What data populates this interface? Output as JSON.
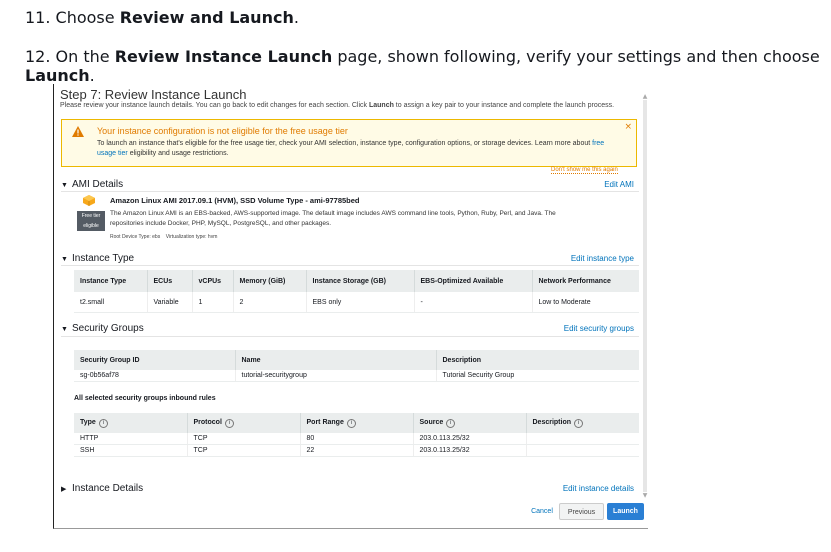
{
  "doc": {
    "step11": {
      "prefix": "11. Choose ",
      "bold": "Review and Launch",
      "suffix": "."
    },
    "step12": {
      "prefix": "12. On the ",
      "bold1": "Review Instance Launch",
      "middle": " page, shown following, verify your settings and then choose ",
      "bold2": "Launch",
      "suffix": "."
    }
  },
  "console": {
    "title": "Step 7: Review Instance Launch",
    "subtitle_pre": "Please review your instance launch details. You can go back to edit changes for each section. Click ",
    "subtitle_bold": "Launch",
    "subtitle_post": " to assign a key pair to your instance and complete the launch process.",
    "alert": {
      "title": "Your instance configuration is not eligible for the free usage tier",
      "body_pre": "To launch an instance that's eligible for the free usage tier, check your AMI selection, instance type, configuration options, or storage devices. Learn more about ",
      "body_link": "free usage tier",
      "body_post": " eligibility and usage restrictions.",
      "close": "×",
      "dont_show": "Don't show me this again"
    },
    "ami": {
      "heading": "AMI Details",
      "edit": "Edit AMI",
      "name": "Amazon Linux AMI 2017.09.1 (HVM), SSD Volume Type - ami-97785bed",
      "badge_line1": "Free tier",
      "badge_line2": "eligible",
      "description": "The Amazon Linux AMI is an EBS-backed, AWS-supported image. The default image includes AWS command line tools, Python, Ruby, Perl, and Java. The repositories include Docker, PHP, MySQL, PostgreSQL, and other packages.",
      "root_device": "Root Device Type: ebs",
      "virtualization": "Virtualization type: hvm"
    },
    "instance_type": {
      "heading": "Instance Type",
      "edit": "Edit instance type",
      "columns": [
        "Instance Type",
        "ECUs",
        "vCPUs",
        "Memory (GiB)",
        "Instance Storage (GB)",
        "EBS-Optimized Available",
        "Network Performance"
      ],
      "row": [
        "t2.small",
        "Variable",
        "1",
        "2",
        "EBS only",
        "-",
        "Low to Moderate"
      ]
    },
    "security_groups": {
      "heading": "Security Groups",
      "edit": "Edit security groups",
      "columns": [
        "Security Group ID",
        "Name",
        "Description"
      ],
      "row": [
        "sg-0b56af78",
        "tutorial-securitygroup",
        "Tutorial Security Group"
      ],
      "inbound_label": "All selected security groups inbound rules",
      "rule_columns": [
        "Type",
        "Protocol",
        "Port Range",
        "Source",
        "Description"
      ],
      "rules": [
        [
          "HTTP",
          "TCP",
          "80",
          "203.0.113.25/32",
          ""
        ],
        [
          "SSH",
          "TCP",
          "22",
          "203.0.113.25/32",
          ""
        ]
      ]
    },
    "instance_details": {
      "heading": "Instance Details",
      "edit": "Edit instance details"
    },
    "footer": {
      "cancel": "Cancel",
      "previous": "Previous",
      "launch": "Launch"
    },
    "colors": {
      "link": "#0073bb",
      "warning": "#e07b00",
      "launch_button": "#2a7fd4"
    }
  }
}
